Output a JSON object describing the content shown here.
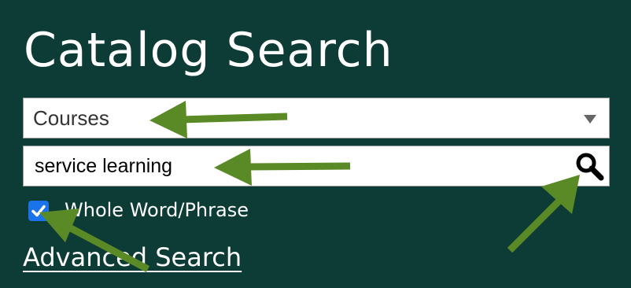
{
  "header": {
    "title": "Catalog Search"
  },
  "search_form": {
    "type_select": {
      "selected": "Courses"
    },
    "keyword": {
      "value": "service learning"
    },
    "whole_word": {
      "label": "Whole Word/Phrase",
      "checked": true
    },
    "advanced_link": "Advanced Search",
    "search_icon": "magnifier-icon"
  },
  "annotations": {
    "arrow_color": "#5a8a26",
    "count": 4
  },
  "colors": {
    "background": "#0d3b36",
    "checkbox": "#1a73e8",
    "text": "#ffffff"
  }
}
